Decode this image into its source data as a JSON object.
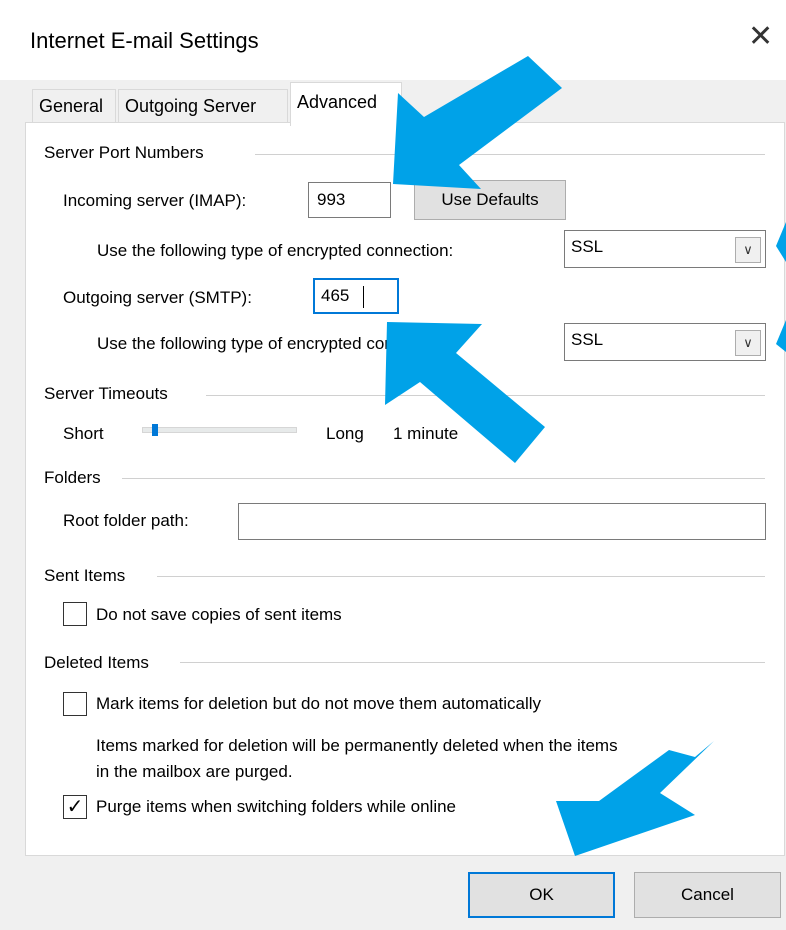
{
  "window": {
    "title": "Internet E-mail Settings",
    "close_glyph": "✕"
  },
  "tabs": [
    {
      "label": "General",
      "active": false
    },
    {
      "label": "Outgoing Server",
      "active": false
    },
    {
      "label": "Advanced",
      "active": true
    }
  ],
  "server_ports": {
    "heading": "Server Port Numbers",
    "incoming_label": "Incoming server (IMAP):",
    "incoming_value": "993",
    "defaults_button": "Use Defaults",
    "incoming_enc_label": "Use the following type of encrypted connection:",
    "incoming_enc_value": "SSL",
    "outgoing_label": "Outgoing server (SMTP):",
    "outgoing_value": "465",
    "outgoing_enc_label": "Use the following type of encrypted connection:",
    "outgoing_enc_value": "SSL"
  },
  "timeouts": {
    "heading": "Server Timeouts",
    "short_label": "Short",
    "long_label": "Long",
    "value_text": "1 minute",
    "slider_level": 0.06
  },
  "folders": {
    "heading": "Folders",
    "root_label": "Root folder path:",
    "root_value": ""
  },
  "sent_items": {
    "heading": "Sent Items",
    "no_copy_label": "Do not save copies of sent items",
    "no_copy_checked": false
  },
  "deleted_items": {
    "heading": "Deleted Items",
    "mark_label": "Mark items for deletion but do not move them automatically",
    "mark_checked": false,
    "note_line1": "Items marked for deletion will be permanently deleted when the items",
    "note_line2": "in the mailbox are purged.",
    "purge_label": "Purge items when switching folders while online",
    "purge_checked": true
  },
  "buttons": {
    "ok": "OK",
    "cancel": "Cancel"
  },
  "icons": {
    "dropdown": "chevron-down-icon",
    "check": "checkmark-icon",
    "annotation": "annotation-arrow-icon"
  },
  "colors": {
    "accent": "#0078d7",
    "annotation_arrow": "#00a2e8",
    "panel_bg": "#ffffff",
    "dialog_bg": "#f0f0f0"
  }
}
